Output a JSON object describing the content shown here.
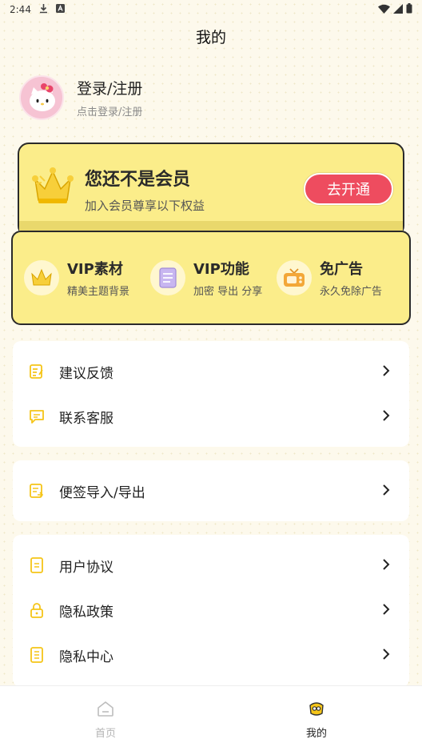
{
  "status_bar": {
    "time": "2:44"
  },
  "header": {
    "title": "我的"
  },
  "profile": {
    "name": "登录/注册",
    "subtitle": "点击登录/注册"
  },
  "vip": {
    "title": "您还不是会员",
    "subtitle": "加入会员尊享以下权益",
    "button_label": "去开通",
    "benefits": [
      {
        "title": "VIP素材",
        "subtitle": "精美主题背景",
        "icon": "crown-icon"
      },
      {
        "title": "VIP功能",
        "subtitle": "加密 导出 分享",
        "icon": "notebook-icon"
      },
      {
        "title": "免广告",
        "subtitle": "永久免除广告",
        "icon": "tv-icon"
      }
    ]
  },
  "menu_groups": [
    [
      {
        "label": "建议反馈",
        "icon": "feedback-icon"
      },
      {
        "label": "联系客服",
        "icon": "chat-icon"
      }
    ],
    [
      {
        "label": "便签导入/导出",
        "icon": "import-export-icon"
      }
    ],
    [
      {
        "label": "用户协议",
        "icon": "document-icon"
      },
      {
        "label": "隐私政策",
        "icon": "lock-icon"
      },
      {
        "label": "隐私中心",
        "icon": "list-icon"
      }
    ]
  ],
  "tabbar": {
    "items": [
      {
        "label": "首页",
        "icon": "home-icon",
        "active": false
      },
      {
        "label": "我的",
        "icon": "mine-icon",
        "active": true
      }
    ]
  },
  "colors": {
    "accent": "#f5c518",
    "vip_bg": "#fbed8a",
    "vip_button": "#ee4c5f",
    "background": "#fdf9ec"
  }
}
